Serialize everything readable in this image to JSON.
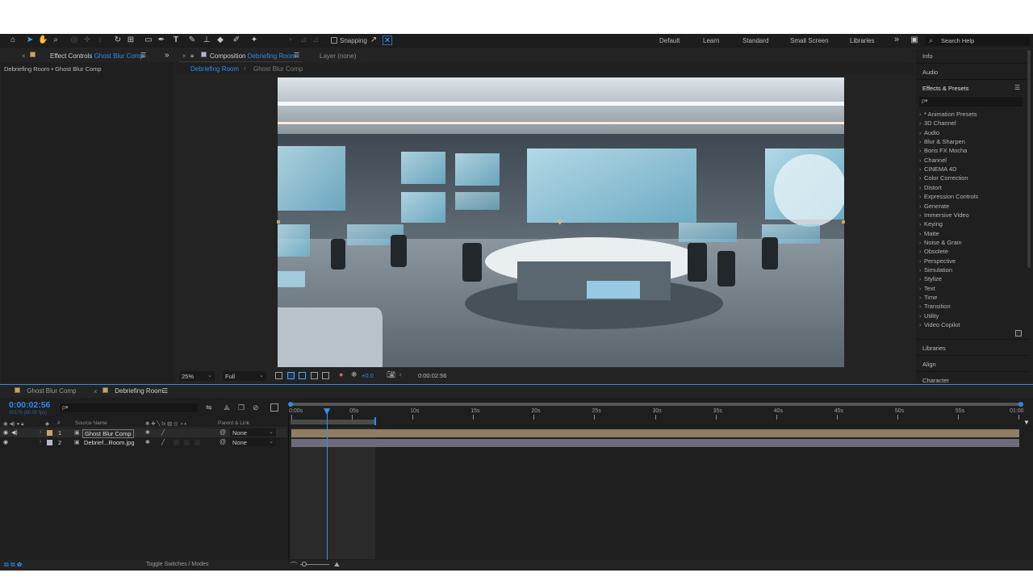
{
  "toolbar": {
    "snapping_label": "Snapping",
    "workspaces": [
      "Default",
      "Learn",
      "Standard",
      "Small Screen",
      "Libraries"
    ],
    "overflow": "»",
    "search_placeholder": "Search Help"
  },
  "effect_controls": {
    "tab_label": "Effect Controls",
    "tab_target": "Ghost Blur Comp",
    "breadcrumb": "Debriefing Room • Ghost Blur Comp"
  },
  "composition": {
    "tab_label": "Composition",
    "tab_target": "Debriefing Room",
    "layer_label": "Layer (none)",
    "nav_active": "Debriefing Room",
    "nav_sep": "‹",
    "nav_other": "Ghost Blur Comp",
    "zoom": "25%",
    "resolution": "Full",
    "exposure": "+0.0",
    "timecode": "0:00:02:56"
  },
  "right_panel": {
    "info": "Info",
    "audio": "Audio",
    "effects_presets": "Effects & Presets",
    "search_icon_text": "ρ▾",
    "categories": [
      "* Animation Presets",
      "3D Channel",
      "Audio",
      "Blur & Sharpen",
      "Boris FX Mocha",
      "Channel",
      "CINEMA 4D",
      "Color Correction",
      "Distort",
      "Expression Controls",
      "Generate",
      "Immersive Video",
      "Keying",
      "Matte",
      "Noise & Grain",
      "Obsolete",
      "Perspective",
      "Simulation",
      "Stylize",
      "Text",
      "Time",
      "Transition",
      "Utility",
      "Video Copilot"
    ],
    "libraries": "Libraries",
    "align": "Align",
    "character": "Character"
  },
  "timeline": {
    "tabs": [
      "Ghost Blur Comp",
      "Debriefing Room"
    ],
    "current_time": "0:00:02:56",
    "frame_info": "00176 (60.00 fps)",
    "search_icon_text": "ρ▾",
    "columns": {
      "hash": "#",
      "source_name": "Source Name",
      "parent_link": "Parent & Link"
    },
    "layers": [
      {
        "num": "1",
        "name": "Ghost Blur Comp",
        "parent": "None",
        "color": "#c5a56a",
        "bar_color": "#8e7f64"
      },
      {
        "num": "2",
        "name": "Debrief...Room.jpg",
        "parent": "None",
        "color": "#b9b3d4",
        "bar_color": "#6f6a7d"
      }
    ],
    "ruler": [
      "0:00s",
      "05s",
      "10s",
      "15s",
      "20s",
      "25s",
      "30s",
      "35s",
      "40s",
      "45s",
      "50s",
      "55s",
      "01:00"
    ],
    "toggle_label": "Toggle Switches / Modes"
  },
  "colors": {
    "accent": "#2d8ceb",
    "panel_bg": "#1e1e1e",
    "app_bg": "#232323"
  }
}
